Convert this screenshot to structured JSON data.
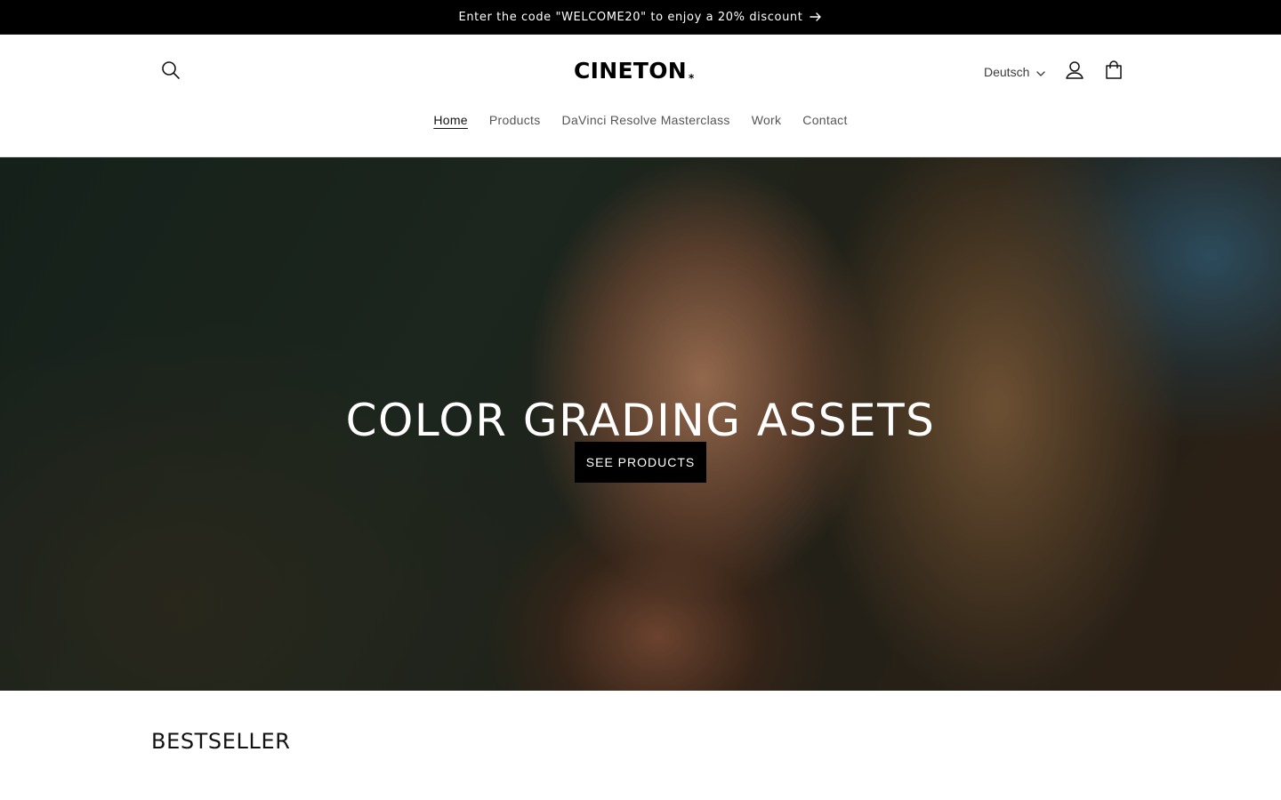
{
  "announcement": {
    "text": "Enter the code \"WELCOME20\" to enjoy a 20% discount",
    "icon": "arrow-right-icon"
  },
  "header": {
    "logo_text": "CINETON",
    "logo_mark": "*",
    "search_icon": "search-icon",
    "language": {
      "selected": "Deutsch",
      "icon": "chevron-down-icon"
    },
    "account_icon": "user-icon",
    "cart_icon": "bag-icon"
  },
  "nav": {
    "items": [
      {
        "label": "Home",
        "active": true
      },
      {
        "label": "Products",
        "active": false
      },
      {
        "label": "DaVinci Resolve Masterclass",
        "active": false
      },
      {
        "label": "Work",
        "active": false
      },
      {
        "label": "Contact",
        "active": false
      }
    ]
  },
  "hero": {
    "title": "COLOR GRADING ASSETS",
    "cta_label": "SEE PRODUCTS"
  },
  "sections": {
    "bestseller_title": "BESTSELLER"
  },
  "colors": {
    "announcement_bg": "#000000",
    "cta_bg": "#000000",
    "text": "#121212"
  }
}
